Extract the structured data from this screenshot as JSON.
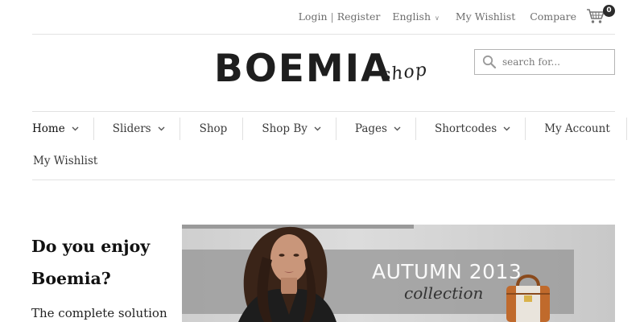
{
  "topbar": {
    "login_label": "Login",
    "separator": "|",
    "register_label": "Register",
    "language": "English",
    "wishlist_label": "My Wishlist",
    "compare_label": "Compare",
    "cart_count": "0"
  },
  "header": {
    "logo_main": "BOEMIA",
    "logo_sub": "shop",
    "search_placeholder": "search for..."
  },
  "nav": {
    "items": [
      {
        "label": "Home"
      },
      {
        "label": "Sliders"
      },
      {
        "label": "Shop"
      },
      {
        "label": "Shop By"
      },
      {
        "label": "Pages"
      },
      {
        "label": "Shortcodes"
      },
      {
        "label": "My Account"
      },
      {
        "label": "My Wishlist"
      }
    ]
  },
  "promo": {
    "title_line1": "Do you enjoy",
    "title_line2": "Boemia?",
    "text": "The complete solution"
  },
  "banner": {
    "heading": "AUTUMN 2013",
    "subheading": "collection"
  },
  "colors": {
    "accent": "#1e1e1e",
    "divider": "#e2e2e2",
    "link": "#6d6d6d"
  }
}
